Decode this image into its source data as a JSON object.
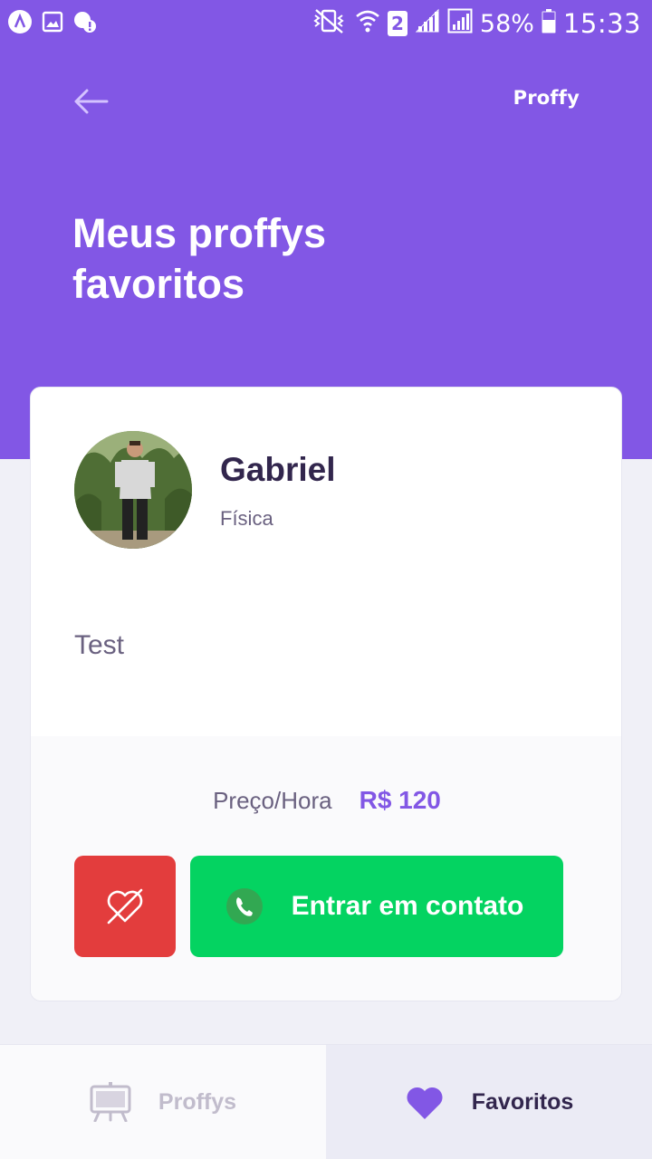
{
  "status_bar": {
    "battery_percent": "58%",
    "time": "15:33",
    "sim_slot": "2",
    "icons": [
      "app-a-icon",
      "gallery-icon",
      "alert-cloud-icon",
      "vibrate-mute-icon",
      "wifi-icon",
      "sim-2-icon",
      "signal-icon",
      "signal-icon-2",
      "battery-icon"
    ]
  },
  "header": {
    "brand": "Proffy",
    "title": "Meus proffys favoritos",
    "back_icon": "arrow-left-icon"
  },
  "teacher_card": {
    "name": "Gabriel",
    "subject": "Física",
    "bio": "Test",
    "price_label": "Preço/Hora",
    "price_value": "R$ 120",
    "unfavorite_icon": "heart-off-icon",
    "contact_label": "Entrar em contato",
    "contact_icon": "whatsapp-icon"
  },
  "tabs": [
    {
      "label": "Proffys",
      "icon": "easel-icon",
      "active": false
    },
    {
      "label": "Favoritos",
      "icon": "heart-icon",
      "active": true
    }
  ],
  "colors": {
    "primary": "#8257E5",
    "background": "#F0F0F7",
    "danger": "#E33D3D",
    "success": "#04D361",
    "title_dark": "#32264D",
    "text_muted": "#6A6180",
    "tab_inactive": "#C1BCCC"
  }
}
